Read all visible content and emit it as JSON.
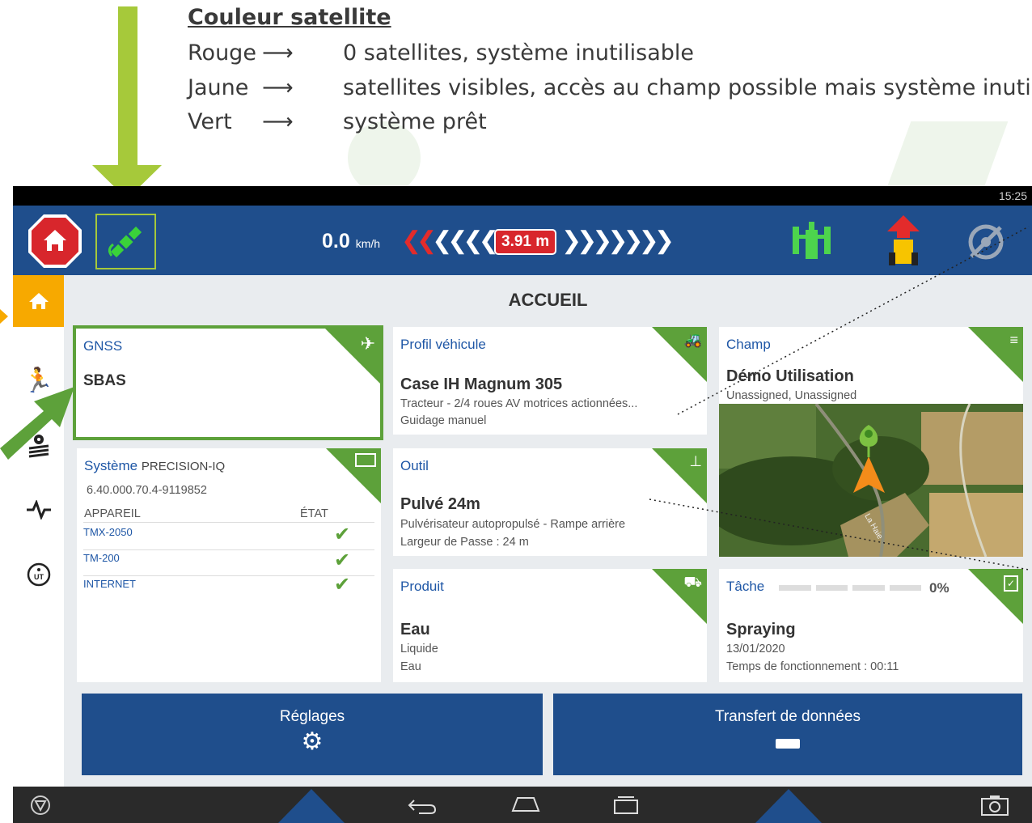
{
  "legend": {
    "title": "Couleur satellite",
    "rows": [
      {
        "color": "Rouge",
        "desc": "0 satellites, système inutilisable"
      },
      {
        "color": "Jaune",
        "desc": "satellites visibles, accès au champ possible mais système inutilisab"
      },
      {
        "color": "Vert",
        "desc": "système prêt"
      }
    ]
  },
  "status": {
    "time": "15:25"
  },
  "topbar": {
    "speed": "0.0",
    "speed_unit": "km/h",
    "offset": "3.91 m"
  },
  "page_title": "ACCUEIL",
  "gnss": {
    "title": "GNSS",
    "value": "SBAS"
  },
  "vehicle": {
    "title": "Profil véhicule",
    "name": "Case IH Magnum 305",
    "desc": "Tracteur - 2/4 roues AV motrices actionnées...",
    "guidance": "Guidage manuel"
  },
  "field": {
    "title": "Champ",
    "name": "Démo Utilisation",
    "desc": "Unassigned, Unassigned",
    "road_label": "La Haie"
  },
  "system": {
    "title": "Système",
    "name": "PRECISION-IQ",
    "version": "6.40.000.70.4-9119852",
    "col_device": "APPAREIL",
    "col_state": "ÉTAT",
    "devices": [
      "TMX-2050",
      "TM-200",
      "INTERNET"
    ]
  },
  "tool": {
    "title": "Outil",
    "name": "Pulvé 24m",
    "desc": "Pulvérisateur autopropulsé - Rampe arrière",
    "width": "Largeur de Passe : 24 m"
  },
  "product": {
    "title": "Produit",
    "name": "Eau",
    "line1": "Liquide",
    "line2": "Eau"
  },
  "task": {
    "title": "Tâche",
    "progress": "0%",
    "progress_value": 0,
    "name": "Spraying",
    "date": "13/01/2020",
    "runtime": "Temps de fonctionnement : 00:11"
  },
  "buttons": {
    "settings": "Réglages",
    "transfer": "Transfert de données"
  },
  "colors": {
    "accent_green": "#5da13a",
    "primary_blue": "#1f4e8c",
    "arrow_lime": "#a6c93a",
    "arrow_navy": "#1f4e8c",
    "home_red": "#d8262c",
    "sidebar_active": "#f7a900"
  }
}
